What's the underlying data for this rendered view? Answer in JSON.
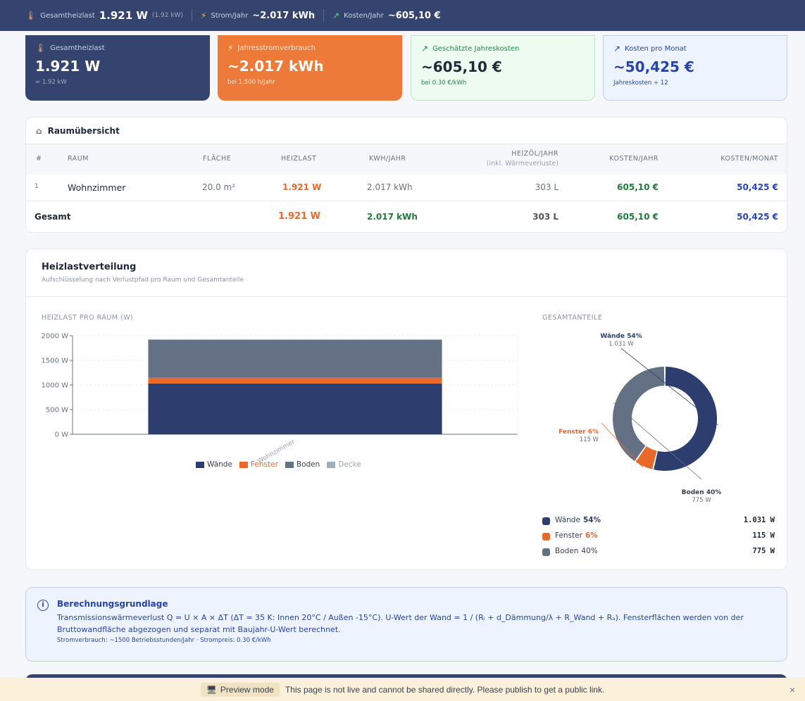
{
  "topbar": {
    "load_label": "Gesamtheizlast",
    "load_value": "1.921 W",
    "load_sub": "(1.92 kW)",
    "power_label": "Strom/Jahr",
    "power_value": "~2.017 kWh",
    "cost_label": "Kosten/Jahr",
    "cost_value": "~605,10 €"
  },
  "cards": [
    {
      "label": "Gesamtheizlast",
      "value": "1.921 W",
      "sub": "≈ 1.92 kW",
      "icon": "thermometer-icon"
    },
    {
      "label": "Jahresstromverbrauch",
      "value": "~2.017 kWh",
      "sub": "bei 1.500 h/Jahr",
      "icon": "lightning-icon"
    },
    {
      "label": "Geschätzte Jahreskosten",
      "value": "~605,10 €",
      "sub": "bei 0.30 €/kWh",
      "icon": "trend-up-icon"
    },
    {
      "label": "Kosten pro Monat",
      "value": "~50,425 €",
      "sub": "Jahreskosten ÷ 12",
      "icon": "trend-up-icon"
    }
  ],
  "rooms": {
    "title": "Raumübersicht",
    "headers": {
      "num": "#",
      "room": "RAUM",
      "area": "FLÄCHE",
      "load": "HEIZLAST",
      "kwh": "KWH/JAHR",
      "oil": "HEIZÖL/JAHR",
      "oil_sub": "(inkl. Wärmeverluste)",
      "cost_year": "KOSTEN/JAHR",
      "cost_month": "KOSTEN/MONAT"
    },
    "rows": [
      {
        "num": "1",
        "room": "Wohnzimmer",
        "area": "20.0 m²",
        "load": "1.921 W",
        "kwh": "2.017 kWh",
        "oil": "303 L",
        "cost_year": "605,10 €",
        "cost_month": "50,425 €"
      }
    ],
    "total": {
      "label": "Gesamt",
      "load": "1.921 W",
      "kwh": "2.017 kWh",
      "oil": "303 L",
      "cost_year": "605,10 €",
      "cost_month": "50,425 €"
    }
  },
  "distribution": {
    "title": "Heizlastverteilung",
    "subtitle": "Aufschlüsselung nach Verlustpfad pro Raum und Gesamtanteile",
    "bar_section_label": "HEIZLAST PRO RAUM (W)",
    "share_section_label": "GESAMTANTEILE",
    "legend": [
      {
        "name": "Wände",
        "color": "#2d3e6e"
      },
      {
        "name": "Fenster",
        "color": "#e8692a"
      },
      {
        "name": "Boden",
        "color": "#647184"
      },
      {
        "name": "Decke",
        "color": "#a3acb9"
      }
    ],
    "shares": [
      {
        "name": "Wände",
        "pct": "54%",
        "watts": "1.031 W",
        "color": "#2d3e6e"
      },
      {
        "name": "Fenster",
        "pct": "6%",
        "watts": "115 W",
        "color": "#e8692a"
      },
      {
        "name": "Boden",
        "pct": "40%",
        "watts": "775 W",
        "color": "#647184"
      }
    ],
    "donut_labels": [
      {
        "title": "Wände 54%",
        "sub": "1.031 W"
      },
      {
        "title": "Fenster 6%",
        "sub": "115 W"
      },
      {
        "title": "Boden 40%",
        "sub": "775 W"
      }
    ]
  },
  "chart_data": [
    {
      "type": "bar",
      "stacked": true,
      "title": "HEIZLAST PRO RAUM (W)",
      "categories": [
        "Wohnzimmer"
      ],
      "series": [
        {
          "name": "Wände",
          "values": [
            1031
          ]
        },
        {
          "name": "Fenster",
          "values": [
            115
          ]
        },
        {
          "name": "Boden",
          "values": [
            775
          ]
        },
        {
          "name": "Decke",
          "values": [
            0
          ]
        }
      ],
      "y_ticks": [
        "0 W",
        "500 W",
        "1000 W",
        "1500 W",
        "2000 W"
      ],
      "ylim": [
        0,
        2000
      ]
    },
    {
      "type": "pie",
      "donut": true,
      "title": "GESAMTANTEILE",
      "labels": [
        "Wände",
        "Fenster",
        "Boden"
      ],
      "values": [
        1031,
        115,
        775
      ]
    }
  ],
  "info": {
    "title": "Berechnungsgrundlage",
    "text": "Transmissionswärmeverlust Q = U × A × ΔT (ΔT = 35 K: Innen 20°C / Außen -15°C). U-Wert der Wand = 1 / (Rᵢ + d_Dämmung/λ + R_Wand + Rₐ). Fensterflächen werden von der Bruttowandfläche abgezogen und separat mit Baujahr-U-Wert berechnet.",
    "footer": "Stromverbrauch: ~1500 Betriebsstunden/Jahr · Strompreis: 0.30 €/kWh"
  },
  "preview": {
    "pill": "Preview mode",
    "message": "This page is not live and cannot be shared directly. Please publish to get a public link.",
    "close": "×"
  }
}
